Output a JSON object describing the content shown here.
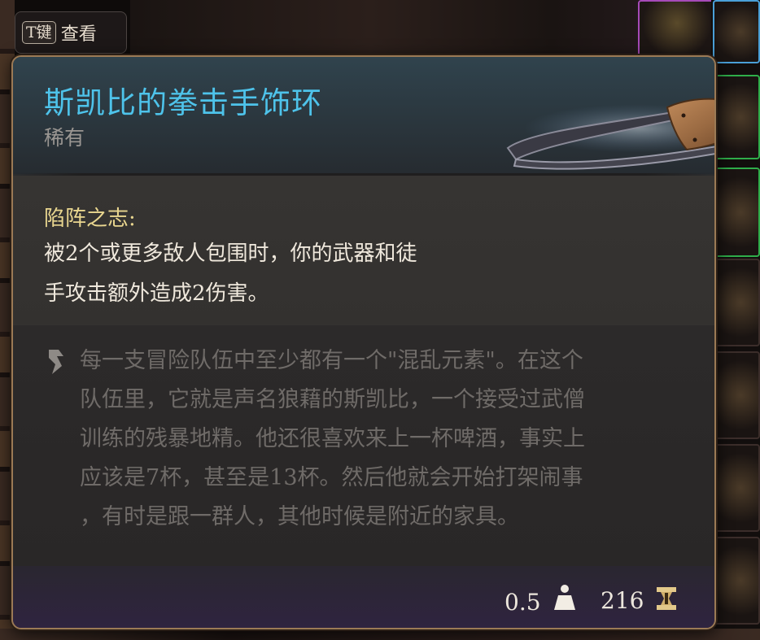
{
  "hint": {
    "key": "T键",
    "label": "查看"
  },
  "item": {
    "name": "斯凯比的拳击手饰环",
    "rarity": "稀有",
    "art_icon": "leather-collar-icon"
  },
  "passive": {
    "name": "陷阵之志:",
    "description_lines": [
      "被2个或更多敌人包围时，你的武器和徒",
      "手攻击额外造成2伤害。"
    ]
  },
  "flavor": {
    "icon": "quote-mark-icon",
    "lines": [
      "每一支冒险队伍中至少都有一个\"混乱元素\"。在这个",
      "队伍里，它就是声名狼藉的斯凯比，一个接受过武僧",
      "训练的残暴地精。他还很喜欢来上一杯啤酒，事实上",
      "应该是7杯，甚至是13杯。然后他就会开始打架闹事",
      "，有时是跟一群人，其他时候是附近的家具。"
    ]
  },
  "stats": {
    "weight": "0.5",
    "weight_icon": "weight-icon",
    "value": "216",
    "value_icon": "gold-coin-icon"
  },
  "colors": {
    "title": "#4ec3ea",
    "rarity": "#9a9692",
    "passive_name": "#e9d68f",
    "flavor_text": "#6f6b68",
    "border": "#9b7a55"
  }
}
